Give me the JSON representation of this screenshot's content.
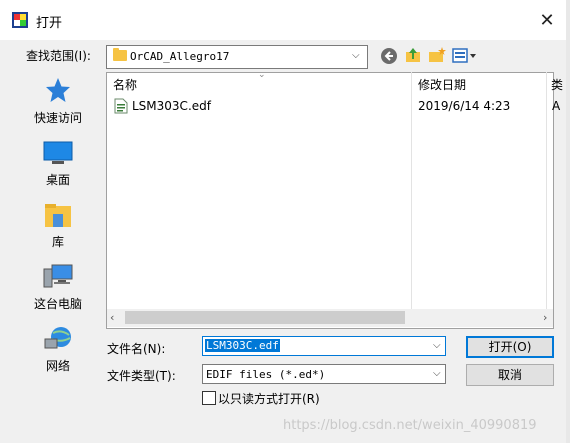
{
  "window": {
    "title": "打开"
  },
  "look_in": {
    "label": "查找范围(I):",
    "value": "OrCAD_Allegro17"
  },
  "places": [
    {
      "label": "快速访问"
    },
    {
      "label": "桌面"
    },
    {
      "label": "库"
    },
    {
      "label": "这台电脑"
    },
    {
      "label": "网络"
    }
  ],
  "columns": {
    "name": "名称",
    "modified": "修改日期",
    "extra": "类"
  },
  "files": [
    {
      "name": "LSM303C.edf",
      "modified": "2019/6/14 4:23",
      "extra": "A"
    }
  ],
  "file_name": {
    "label": "文件名(N):",
    "value": "LSM303C.edf"
  },
  "file_type": {
    "label": "文件类型(T):",
    "value": "EDIF files (*.ed*)"
  },
  "read_only": {
    "label": "以只读方式打开(R)",
    "checked": false
  },
  "buttons": {
    "open": "打开(O)",
    "cancel": "取消"
  },
  "watermark": "https://blog.csdn.net/weixin_40990819",
  "colors": {
    "accent": "#0078d7",
    "dialog_bg": "#f0f0f0"
  }
}
